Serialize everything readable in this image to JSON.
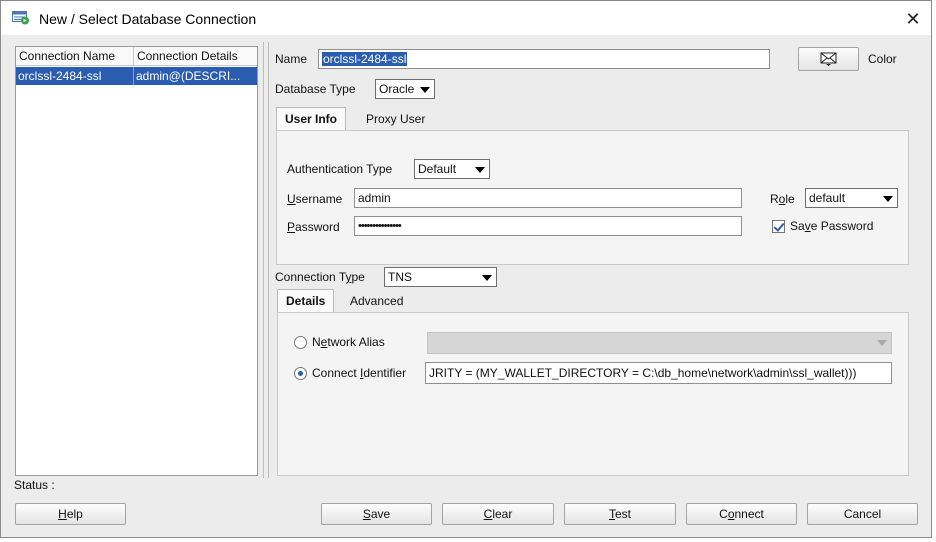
{
  "window": {
    "title": "New / Select Database Connection",
    "icon": "database-connection-icon",
    "close_glyph": "✕"
  },
  "connections": {
    "headers": [
      "Connection Name",
      "Connection Details"
    ],
    "rows": [
      {
        "name": "orclssl-2484-ssl",
        "details": "admin@(DESCRI...",
        "selected": true
      }
    ]
  },
  "status": {
    "label": "Status :"
  },
  "form": {
    "name_label": "Name",
    "name_value": "orclssl-2484-ssl",
    "color_label": "Color",
    "color_icon": "envelope-icon",
    "db_type_label": "Database Type",
    "db_type_value": "Oracle",
    "tabs": [
      {
        "label": "User Info",
        "active": true
      },
      {
        "label": "Proxy User",
        "active": false
      }
    ],
    "auth_type_label": "Authentication Type",
    "auth_type_value": "Default",
    "username_label_prefix": "",
    "username_label_u": "U",
    "username_label_rest": "sername",
    "username_value": "admin",
    "password_label_u": "P",
    "password_label_rest": "assword",
    "password_value": "•••••••••••••••",
    "role_label_pre": "R",
    "role_label_u": "o",
    "role_label_rest": "le",
    "role_value": "default",
    "save_password_pre": "Sa",
    "save_password_u": "v",
    "save_password_rest": "e Password",
    "save_password_checked": true,
    "connection_type_label_pre": "Connection T",
    "connection_type_label_u": "y",
    "connection_type_label_rest": "pe",
    "connection_type_value": "TNS",
    "detail_tabs": [
      {
        "label": "Details",
        "active": true
      },
      {
        "label": "Advanced",
        "active": false
      }
    ],
    "network_alias_pre": "N",
    "network_alias_u": "e",
    "network_alias_rest": "twork Alias",
    "network_alias_selected": false,
    "connect_id_pre": "Connect ",
    "connect_id_u": "I",
    "connect_id_rest": "dentifier",
    "connect_id_selected": true,
    "connect_id_value": "JRITY = (MY_WALLET_DIRECTORY = C:\\db_home\\network\\admin\\ssl_wallet)))"
  },
  "buttons": {
    "help_u": "H",
    "help_rest": "elp",
    "save_u": "S",
    "save_rest": "ave",
    "clear_u": "C",
    "clear_rest": "lear",
    "test_u": "T",
    "test_rest": "est",
    "connect_pre": "C",
    "connect_u": "o",
    "connect_rest": "nnect",
    "cancel": "Cancel"
  }
}
